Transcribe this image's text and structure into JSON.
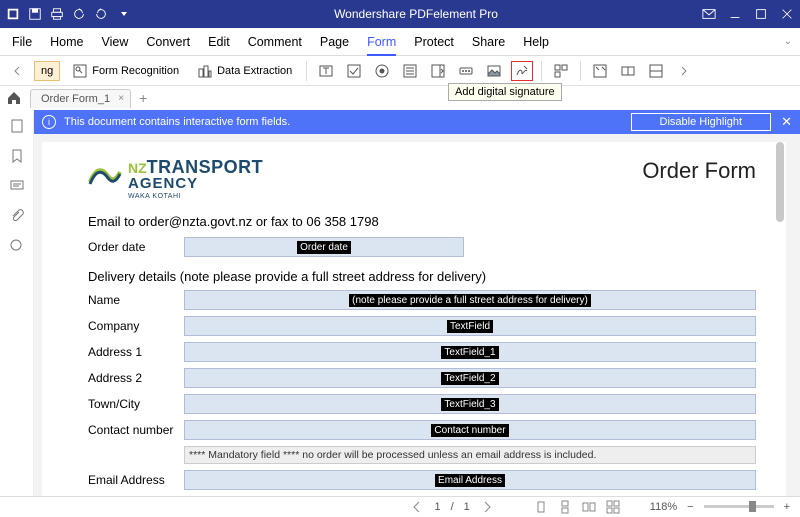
{
  "titlebar": {
    "app_title": "Wondershare PDFelement Pro"
  },
  "menubar": {
    "items": [
      "File",
      "Home",
      "View",
      "Convert",
      "Edit",
      "Comment",
      "Page",
      "Form",
      "Protect",
      "Share",
      "Help"
    ],
    "active_index": 7
  },
  "ribbon": {
    "form_recognition": "Form Recognition",
    "data_extraction": "Data Extraction",
    "tooltip": "Add digital signature"
  },
  "tabs": {
    "items": [
      {
        "label": "Order Form_1"
      }
    ]
  },
  "banner": {
    "text": "This document contains interactive form fields.",
    "button": "Disable Highlight"
  },
  "form": {
    "brand": {
      "l1": "TRANSPORT",
      "l2": "AGENCY",
      "l3": "WAKA KOTAHI",
      "prefix": "NZ"
    },
    "title": "Order Form",
    "email_line": "Email to order@nzta.govt.nz or fax to 06 358 1798",
    "order_date_label": "Order date",
    "order_date_ph": "Order date",
    "section_header": "Delivery details (note please provide a full street address for delivery)",
    "rows": [
      {
        "label": "Name",
        "ph": "(note please provide a full street address for delivery)"
      },
      {
        "label": "Company",
        "ph": "TextField"
      },
      {
        "label": "Address 1",
        "ph": "TextField_1"
      },
      {
        "label": "Address 2",
        "ph": "TextField_2"
      },
      {
        "label": "Town/City",
        "ph": "TextField_3"
      },
      {
        "label": "Contact number",
        "ph": "Contact number"
      }
    ],
    "mandatory_note": "**** Mandatory field **** no order will be processed unless an email address is included.",
    "email_label": "Email Address",
    "email_ph": "Email Address"
  },
  "status": {
    "page_current": "1",
    "page_sep": "/",
    "page_total": "1",
    "zoom": "118%"
  }
}
